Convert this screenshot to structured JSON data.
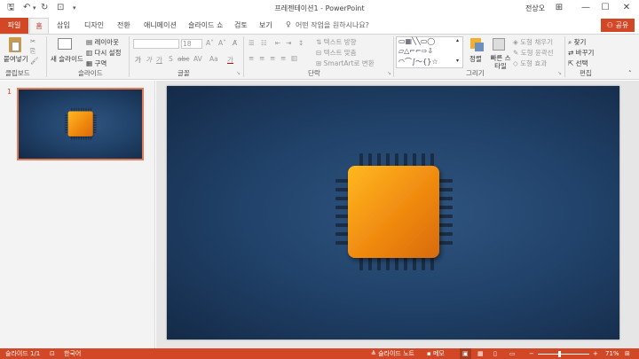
{
  "window": {
    "title": "프레젠테이션1 - PowerPoint",
    "user": "전상오",
    "minimize": "—",
    "restore": "☐",
    "close": "✕"
  },
  "tabs": {
    "file": "파일",
    "home": "홈",
    "items": [
      "삽입",
      "디자인",
      "전환",
      "애니메이션",
      "슬라이드 쇼",
      "검토",
      "보기"
    ],
    "tell_me": "어떤 작업을 원하시나요?",
    "share": "공유"
  },
  "ribbon": {
    "clipboard": {
      "paste": "붙여넣기",
      "group": "클립보드"
    },
    "slides": {
      "new_slide": "새 슬라이드",
      "layout": "레이아웃",
      "reset": "다시 설정",
      "section": "구역",
      "group": "슬라이드"
    },
    "font": {
      "size": "18",
      "group": "글꼴",
      "bold": "가",
      "italic": "가",
      "underline": "가",
      "shadow": "S",
      "strike": "abc",
      "spacing": "AV",
      "case": "Aa",
      "color": "가"
    },
    "paragraph": {
      "text_direction": "텍스트 방향",
      "align_text": "텍스트 맞춤",
      "smartart": "SmartArt로 변환",
      "group": "단락"
    },
    "drawing": {
      "arrange": "정렬",
      "quick_styles": "빠른 스타일",
      "fill": "도형 채우기",
      "outline": "도형 윤곽선",
      "effects": "도형 효과",
      "group": "그리기"
    },
    "editing": {
      "find": "찾기",
      "replace": "바꾸기",
      "select": "선택",
      "group": "편집"
    }
  },
  "thumbnails": [
    {
      "number": "1"
    }
  ],
  "status": {
    "slide": "슬라이드 1/1",
    "language": "한국어",
    "notes": "슬라이드 노트",
    "comments": "메모",
    "zoom": "71%"
  },
  "colors": {
    "accent": "#d24726",
    "slide_bg": "#22446c",
    "chip": "#f08a10"
  }
}
